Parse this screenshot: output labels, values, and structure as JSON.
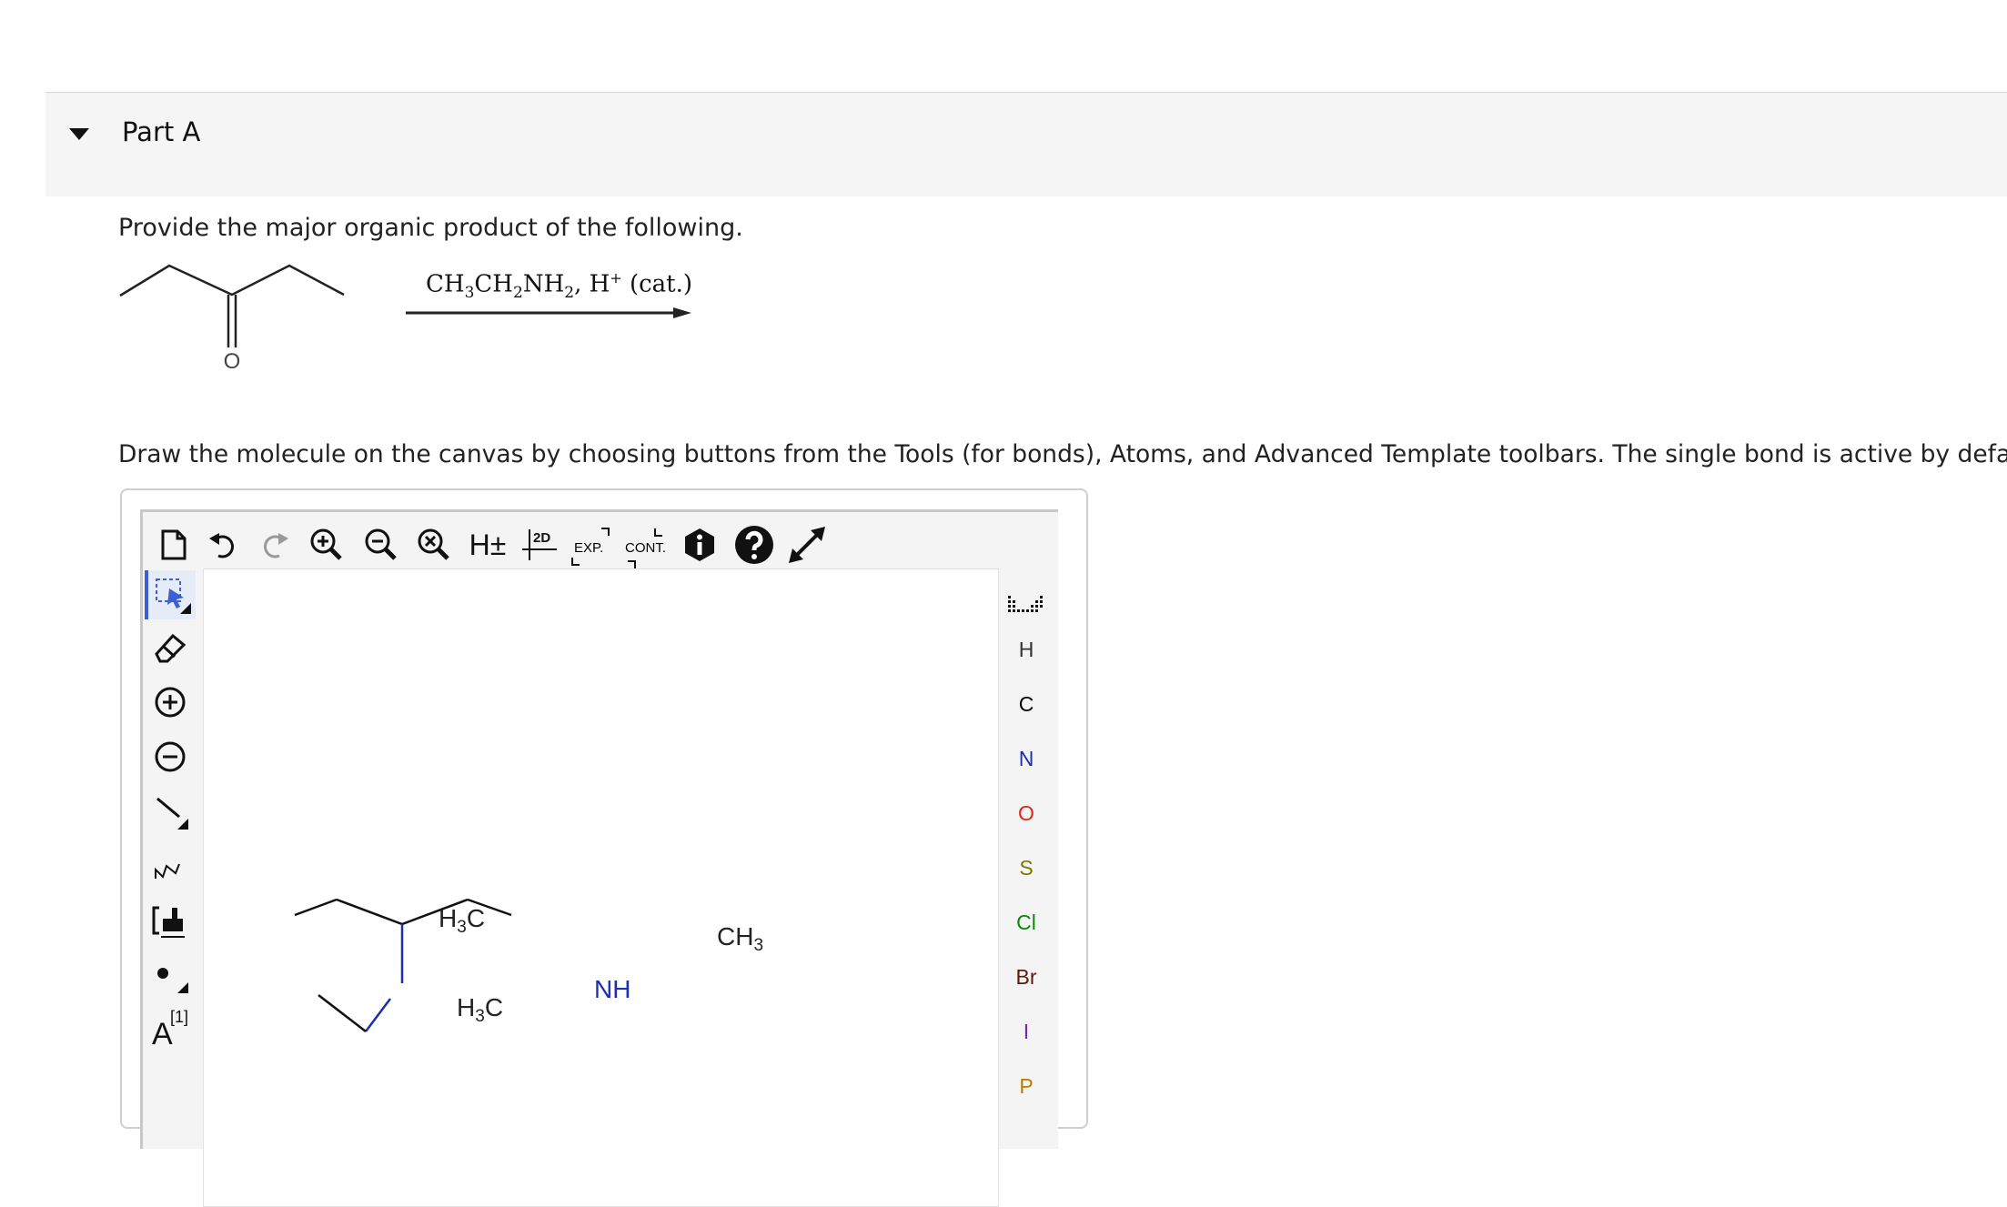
{
  "part": {
    "title": "Part A"
  },
  "question": {
    "prompt": "Provide the major organic product of the following.",
    "reactant_atom_label": "O",
    "reagent": {
      "main": "CH",
      "sub1": "3",
      "mid": "CH",
      "sub2": "2",
      "nh": "NH",
      "sub3": "2",
      "sep": ", H",
      "sup": "+",
      "cat": " (cat.)"
    },
    "instructions": "Draw the molecule on the canvas by choosing buttons from the Tools (for bonds), Atoms, and Advanced Template toolbars. The single bond is active by default."
  },
  "toolbar_top": {
    "labels": {
      "clean2d": "2D",
      "expand": "EXP.",
      "contract": "CONT.",
      "hydrogen": "H±"
    }
  },
  "left_tools": {
    "charge_label": "A",
    "charge_sup": "[1]"
  },
  "atoms": [
    {
      "symbol": "H",
      "color": "#333333"
    },
    {
      "symbol": "C",
      "color": "#000000"
    },
    {
      "symbol": "N",
      "color": "#1c2fb0"
    },
    {
      "symbol": "O",
      "color": "#e0251b"
    },
    {
      "symbol": "S",
      "color": "#7a7a00"
    },
    {
      "symbol": "Cl",
      "color": "#0a8a0a"
    },
    {
      "symbol": "Br",
      "color": "#5c1a0e"
    },
    {
      "symbol": "I",
      "color": "#7a2aa0"
    },
    {
      "symbol": "P",
      "color": "#c07a00"
    }
  ],
  "molecule": {
    "left_top": {
      "main": "H",
      "sub": "3",
      "tail": "C"
    },
    "right": {
      "main": "CH",
      "sub": "3"
    },
    "left_bottom": {
      "main": "H",
      "sub": "3",
      "tail": "C"
    },
    "nh": "NH"
  },
  "colors": {
    "accent": "#3d5fd6",
    "nitrogen": "#1c2fb0"
  }
}
